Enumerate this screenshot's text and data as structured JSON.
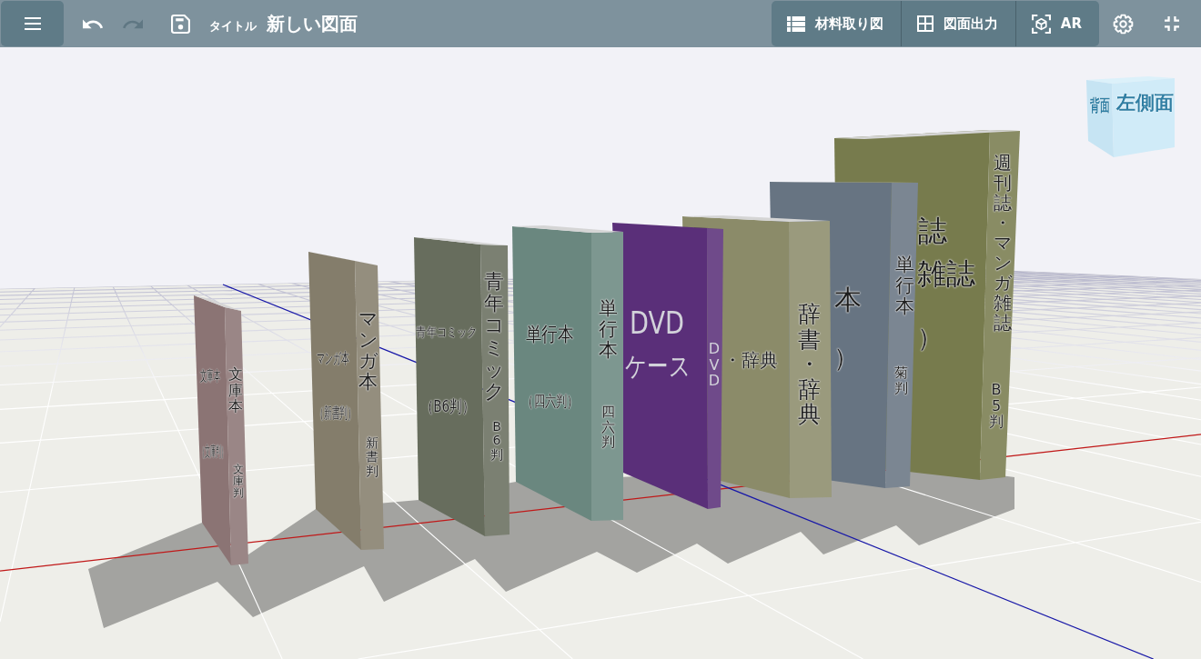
{
  "toolbar": {
    "undo": {
      "disabled": false
    },
    "redo": {
      "disabled": true
    },
    "title_label": "タイトル",
    "title": "新しい図面",
    "actions": [
      {
        "kind": "cut-list",
        "label": "材料取り図"
      },
      {
        "kind": "export",
        "label": "図面出力"
      },
      {
        "kind": "ar",
        "label": "AR"
      }
    ]
  },
  "scene": {
    "view_cube": {
      "labels": [
        "背面",
        "左側面"
      ]
    },
    "books": [
      {
        "kind": "book",
        "color": "#8b7474",
        "cover": [
          "文庫本",
          "（文庫判）"
        ],
        "spine": [
          "文庫本",
          "文庫判"
        ]
      },
      {
        "kind": "book",
        "color": "#847d6b",
        "cover": [
          "マンガ本",
          "（新書判）"
        ],
        "spine": [
          "マンガ本",
          "新書判"
        ]
      },
      {
        "kind": "book",
        "color": "#676d5d",
        "cover": [
          "青年コミック",
          "（B6判）"
        ],
        "spine": [
          "青年コミック",
          "B6判"
        ]
      },
      {
        "kind": "book",
        "color": "#6a877f",
        "cover": [
          "単行本",
          "（四六判）"
        ],
        "spine": [
          "単行本",
          "四六判"
        ]
      },
      {
        "kind": "case",
        "color": "#5a2f79",
        "cover": [
          "DVD",
          "ケース"
        ],
        "spine": [
          "DVD"
        ]
      },
      {
        "kind": "book",
        "color": "#8b8b69",
        "cover": [
          "・辞典"
        ],
        "spine": [
          "辞書・辞典"
        ]
      },
      {
        "kind": "book",
        "color": "#677482",
        "cover": [
          "本",
          "）"
        ],
        "spine": [
          "単行本",
          "菊判"
        ]
      },
      {
        "kind": "book",
        "color": "#777b4d",
        "cover": [
          "誌",
          "雑誌",
          "）"
        ],
        "spine": [
          "週刊誌・マンガ雑誌",
          "B5判"
        ]
      }
    ]
  }
}
